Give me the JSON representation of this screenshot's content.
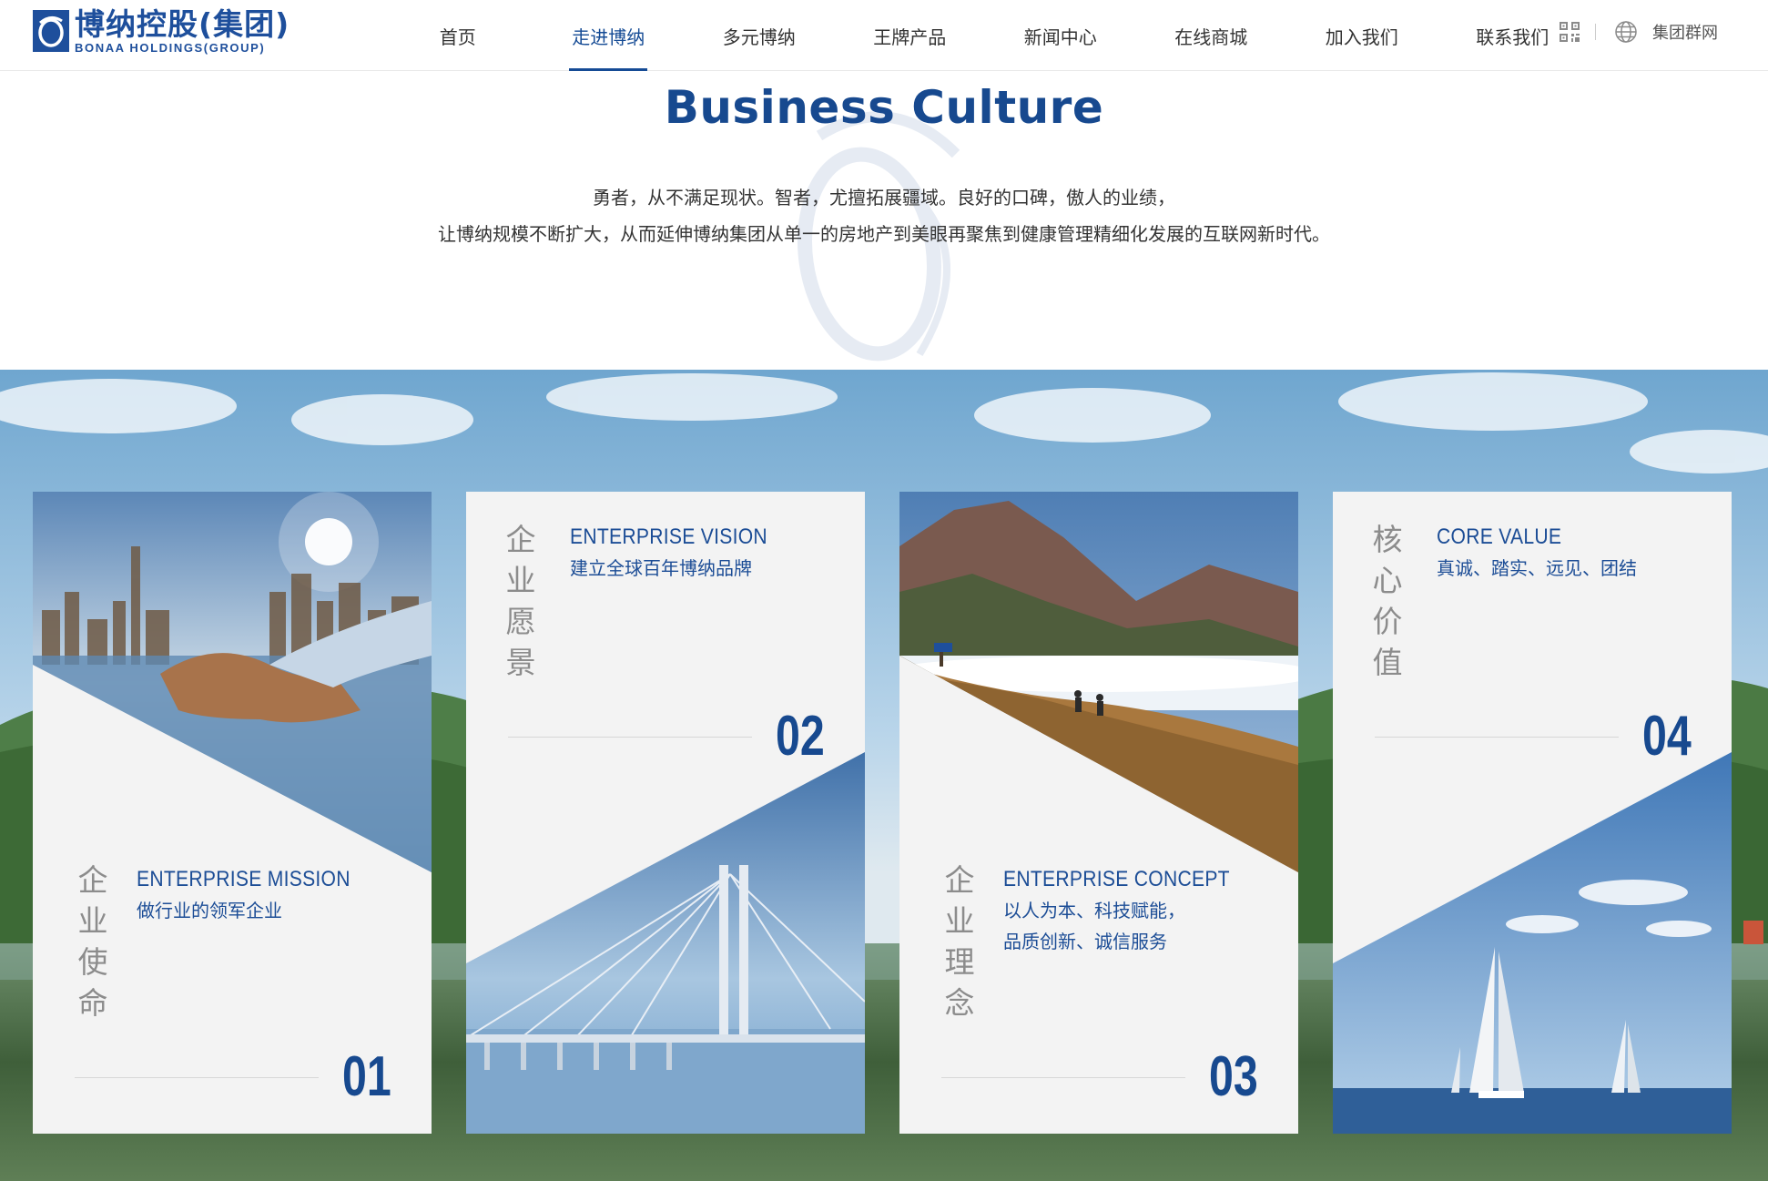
{
  "header": {
    "logo": {
      "name_cn": "博纳控股(集团)",
      "name_en": "BONAA HOLDINGS(GROUP)"
    },
    "nav": [
      {
        "label": "首页",
        "active": false
      },
      {
        "label": "走进博纳",
        "active": true
      },
      {
        "label": "多元博纳",
        "active": false
      },
      {
        "label": "王牌产品",
        "active": false
      },
      {
        "label": "新闻中心",
        "active": false
      },
      {
        "label": "在线商城",
        "active": false
      },
      {
        "label": "加入我们",
        "active": false
      },
      {
        "label": "联系我们",
        "active": false
      }
    ],
    "tools": {
      "qr_icon": "qr-code-icon",
      "globe_icon": "globe-icon",
      "group_link": "集团群网"
    }
  },
  "culture": {
    "title": "Business Culture",
    "lines": [
      "勇者，从不满足现状。智者，尤擅拓展疆域。良好的口碑，傲人的业绩，",
      "让博纳规模不断扩大，从而延伸博纳集团从单一的房地产到美眼再聚焦到健康管理精细化发展的互联网新时代。"
    ]
  },
  "cards": [
    {
      "cn": "企业使命",
      "en": "ENTERPRISE MISSION",
      "desc": [
        "做行业的领军企业"
      ],
      "num": "01",
      "image": "handshake-city"
    },
    {
      "cn": "企业愿景",
      "en": "ENTERPRISE VISION",
      "desc": [
        "建立全球百年博纳品牌"
      ],
      "num": "02",
      "image": "bridge"
    },
    {
      "cn": "企业理念",
      "en": "ENTERPRISE CONCEPT",
      "desc": [
        "以人为本、科技赋能，",
        "品质创新、诚信服务"
      ],
      "num": "03",
      "image": "mountain-hikers"
    },
    {
      "cn": "核心价值",
      "en": "CORE VALUE",
      "desc": [
        "真诚、踏实、远见、团结"
      ],
      "num": "04",
      "image": "sailboats"
    }
  ],
  "colors": {
    "brand": "#17498f",
    "nav_active": "#154b95",
    "card_bg": "#f3f3f3",
    "cn_label": "#8c8c8c"
  }
}
